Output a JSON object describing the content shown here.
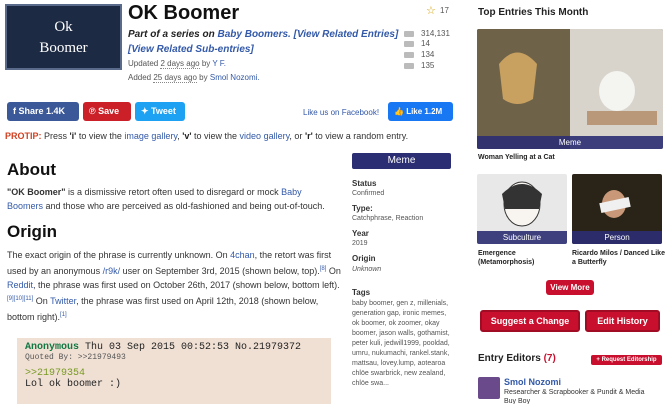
{
  "header": {
    "logo_text": "Ok\nBoomer",
    "title": "OK Boomer",
    "series_prefix": "Part of a series on ",
    "series_name": "Baby Boomers.",
    "view_related_entries": "[View Related Entries]",
    "view_related_subentries": "[View Related Sub-entries]",
    "updated_prefix": "Updated ",
    "updated_when": "2 days ago",
    "updated_by": " by ",
    "updated_user": "Y F.",
    "added_prefix": "Added ",
    "added_when": "25 days ago",
    "added_by": " by ",
    "added_user": "Smol Nozomi."
  },
  "stats": {
    "favorites": "17",
    "views": "314,131",
    "videos": "14",
    "images": "134",
    "comments": "135"
  },
  "share": {
    "fb_label": "Share 1.4K",
    "pin_label": "Save",
    "tw_label": "Tweet",
    "like_text": "Like us on Facebook!",
    "like_label": "Like 1.2M"
  },
  "protip": {
    "label": "PROTIP:",
    "t1": " Press ",
    "key1": "'i'",
    "t2": " to view the ",
    "link1": "image gallery",
    "t3": ", ",
    "key2": "'v'",
    "t4": " to view the ",
    "link2": "video gallery",
    "t5": ", or ",
    "key3": "'r'",
    "t6": " to view a random entry."
  },
  "about": {
    "heading": "About",
    "quote": "\"OK Boomer\"",
    "t1": " is a dismissive retort often used to disregard or mock ",
    "link": "Baby Boomers",
    "t2": " and those who are perceived as old-fashioned and being out-of-touch."
  },
  "origin": {
    "heading": "Origin",
    "t1": "The exact origin of the phrase is currently unknown. On ",
    "link1": "4chan",
    "t2": ", the retort was first used by an anonymous ",
    "link2": "/r9k/",
    "t3": " user on September 3rd, 2015 (shown below, top).",
    "ref1": "[8]",
    "t4": " On ",
    "link3": "Reddit",
    "t5": ", the phrase was first used on October 26th, 2017 (shown below, bottom left).",
    "ref2": "[9][10][11]",
    "t6": " On ",
    "link4": "Twitter",
    "t7": ", the phrase was first used on April 12th, 2018 (shown below, bottom right).",
    "ref3": "[1]"
  },
  "post": {
    "name": "Anonymous",
    "meta": " Thu 03 Sep 2015 00:52:53 No.21979372",
    "quoted": "Quoted By: >>21979493",
    "reply": ">>21979354",
    "text": "Lol ok boomer :)"
  },
  "info": {
    "badge": "Meme",
    "status_label": "Status",
    "status": "Confirmed",
    "type_label": "Type:",
    "type": "Catchphrase, Reaction",
    "year_label": "Year",
    "year": "2019",
    "origin_label": "Origin",
    "origin": "Unknown",
    "tags_label": "Tags",
    "tags": "baby boomer, gen z, millenials, generation gap, ironic memes, ok boomer, ok zoomer, okay boomer, jason walls, gothamist, peter kuli, jedwill1999, pooldad, umru, nukumachi, rankel.stank, mattsau, lovey.lump, aotearoa chlöe swarbrick, new zealand, chlöe swa..."
  },
  "sidebar": {
    "top_heading": "Top Entries This Month",
    "entry1_cat": "Meme",
    "entry1_name": "Woman Yelling at a Cat",
    "entry2_cat": "Subculture",
    "entry2_name": "Emergence (Metamorphosis)",
    "entry3_cat": "Person",
    "entry3_name": "Ricardo Milos / Danced Like a Butterfly",
    "view_more": "View More",
    "suggest_change": "Suggest a Change",
    "edit_history": "Edit History",
    "editors_label": "Entry Editors ",
    "editors_count": "(7)",
    "request_editorship": "+ Request Editorship",
    "editor_name": "Smol Nozomi",
    "editor_role": "Researcher & Scrapbooker & Pundit & Media Buy Boy"
  },
  "colors": {
    "badge_navy": "#2b2e72",
    "accent_red": "#c8102e",
    "link_blue": "#3359a8",
    "post_bg": "#f0e0d4",
    "greentext": "#789922"
  }
}
